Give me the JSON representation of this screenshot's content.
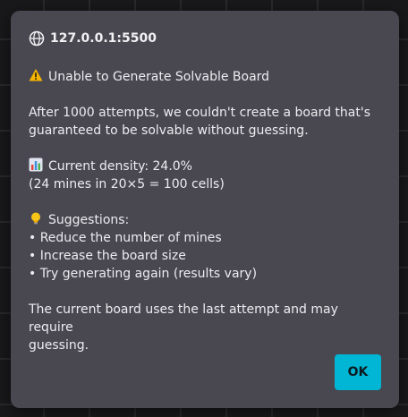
{
  "dialog": {
    "origin": "127.0.0.1:5500",
    "title": "Unable to Generate Solvable Board",
    "intro_line1": "After 1000 attempts, we couldn't create a board that's",
    "intro_line2": "guaranteed to be solvable without guessing.",
    "density_label": "Current density: 24.0%",
    "density_detail": "(24 mines in 20×5 = 100 cells)",
    "suggestions_label": "Suggestions:",
    "suggestions": [
      "• Reduce the number of mines",
      "• Increase the board size",
      "• Try generating again (results vary)"
    ],
    "footer_line1": "The current board uses the last attempt and may require",
    "footer_line2": "guessing.",
    "ok_label": "OK",
    "icons": {
      "origin": "globe-icon",
      "title": "warning-icon",
      "density": "bar-chart-icon",
      "suggestions": "lightbulb-icon"
    },
    "colors": {
      "dialog_bg": "#494851",
      "text": "#ececf0",
      "accent": "#00b6d4",
      "warning": "#f5b400"
    }
  }
}
